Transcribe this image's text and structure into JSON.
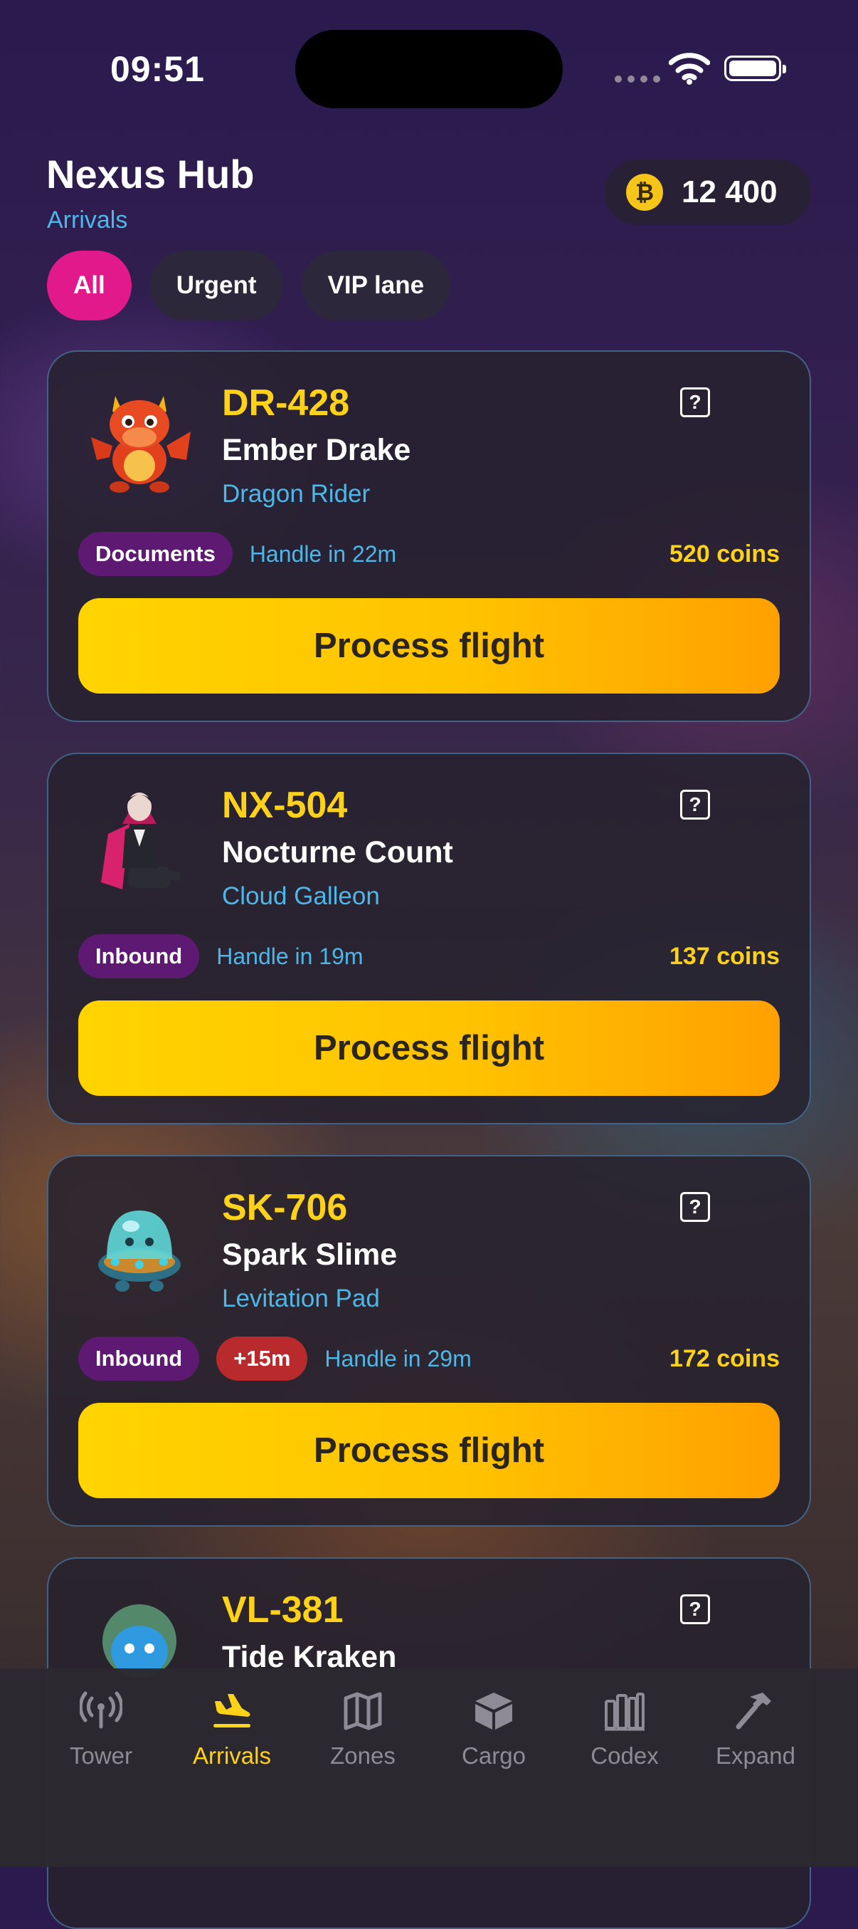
{
  "status_bar": {
    "time": "09:51"
  },
  "header": {
    "title": "Nexus Hub",
    "subtitle": "Arrivals",
    "coin_symbol": "₿",
    "coin_balance": "12 400"
  },
  "filters": [
    {
      "label": "All",
      "active": true
    },
    {
      "label": "Urgent",
      "active": false
    },
    {
      "label": "VIP lane",
      "active": false
    }
  ],
  "flights": [
    {
      "id": "DR-428",
      "name": "Ember Drake",
      "craft": "Dragon Rider",
      "avatar_icon": "red-dragon-icon",
      "badges": [
        {
          "label": "Documents",
          "color": "#5e1a72"
        }
      ],
      "handle": "Handle in 22m",
      "reward": "520 coins",
      "action": "Process flight",
      "help": "?"
    },
    {
      "id": "NX-504",
      "name": "Nocturne Count",
      "craft": "Cloud Galleon",
      "avatar_icon": "vampire-count-icon",
      "badges": [
        {
          "label": "Inbound",
          "color": "#5e1a72"
        }
      ],
      "handle": "Handle in 19m",
      "reward": "137 coins",
      "action": "Process flight",
      "help": "?"
    },
    {
      "id": "SK-706",
      "name": "Spark Slime",
      "craft": "Levitation Pad",
      "avatar_icon": "slime-pod-icon",
      "badges": [
        {
          "label": "Inbound",
          "color": "#5e1a72"
        },
        {
          "label": "+15m",
          "color": "#b82a2c"
        }
      ],
      "handle": "Handle in 29m",
      "reward": "172 coins",
      "action": "Process flight",
      "help": "?"
    },
    {
      "id": "VL-381",
      "name": "Tide Kraken",
      "avatar_icon": "kraken-icon",
      "help": "?"
    }
  ],
  "tabs": [
    {
      "label": "Tower",
      "icon": "antenna-icon",
      "active": false
    },
    {
      "label": "Arrivals",
      "icon": "plane-landing-icon",
      "active": true
    },
    {
      "label": "Zones",
      "icon": "map-icon",
      "active": false
    },
    {
      "label": "Cargo",
      "icon": "package-icon",
      "active": false
    },
    {
      "label": "Codex",
      "icon": "books-icon",
      "active": false
    },
    {
      "label": "Expand",
      "icon": "hammer-icon",
      "active": false
    }
  ],
  "colors": {
    "accent_yellow": "#ffd21a",
    "accent_pink": "#e2198b",
    "link_blue": "#4fb7e8",
    "badge_purple": "#5e1a72",
    "badge_red": "#b82a2c"
  }
}
